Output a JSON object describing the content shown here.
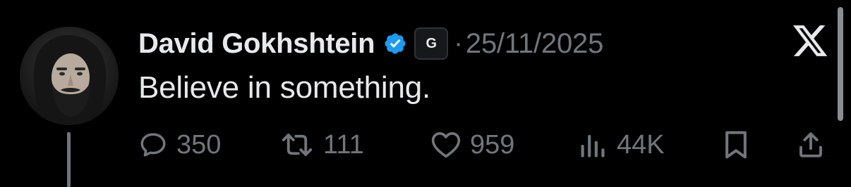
{
  "author": {
    "display_name": "David Gokhshtein",
    "affiliate_badge": "G",
    "separator": "·",
    "date": "25/11/2025"
  },
  "tweet": {
    "text": "Believe in something."
  },
  "actions": {
    "replies": "350",
    "reposts": "111",
    "likes": "959",
    "views": "44K"
  },
  "icons": {
    "verified": "verified-badge-icon",
    "brand": "x-logo-icon",
    "reply": "reply-icon",
    "repost": "repost-icon",
    "like": "heart-icon",
    "views": "views-chart-icon",
    "bookmark": "bookmark-icon",
    "share": "share-icon"
  },
  "colors": {
    "background": "#000000",
    "primary_text": "#e7e9ea",
    "secondary_text": "#71767b",
    "verified_blue": "#1d9bf0"
  }
}
